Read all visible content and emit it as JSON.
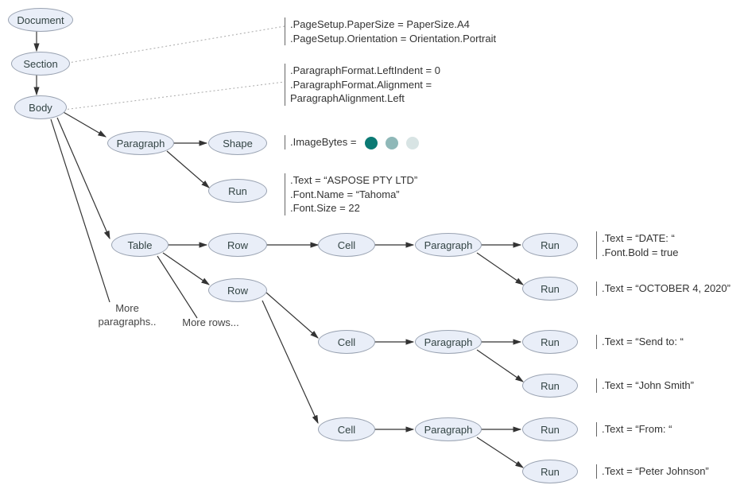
{
  "nodes": {
    "document": "Document",
    "section": "Section",
    "body": "Body",
    "paragraph1": "Paragraph",
    "shape": "Shape",
    "run_shape": "Run",
    "table": "Table",
    "row1": "Row",
    "row2": "Row",
    "cell1": "Cell",
    "cell2": "Cell",
    "cell3": "Cell",
    "para_c1": "Paragraph",
    "para_c2": "Paragraph",
    "para_c3": "Paragraph",
    "run_c1a": "Run",
    "run_c1b": "Run",
    "run_c2a": "Run",
    "run_c2b": "Run",
    "run_c3a": "Run",
    "run_c3b": "Run"
  },
  "annotations": {
    "section1": ".PageSetup.PaperSize = PaperSize.A4",
    "section2": ".PageSetup.Orientation = Orientation.Portrait",
    "para_fmt1": ".ParagraphFormat.LeftIndent = 0",
    "para_fmt2": ".ParagraphFormat.Alignment =",
    "para_fmt3": "ParagraphAlignment.Left",
    "imagebytes": ".ImageBytes =",
    "run1_l1": ".Text = “ASPOSE PTY LTD”",
    "run1_l2": ".Font.Name = “Tahoma”",
    "run1_l3": ".Font.Size = 22",
    "run_date1": ".Text = “DATE: “",
    "run_date2": ".Font.Bold = true",
    "run_oct": ".Text = “OCTOBER 4, 2020”",
    "run_sendto": ".Text = “Send to: “",
    "run_john": ".Text = “John Smith”",
    "run_from": ".Text = “From: “",
    "run_peter": ".Text = “Peter Johnson”"
  },
  "notes": {
    "more_para": "More\nparagraphs..",
    "more_rows": "More rows..."
  },
  "colors": {
    "dot1": "#0b7a74",
    "dot2": "#8fb8b8",
    "dot3": "#d8e4e4"
  },
  "chart_data": {
    "type": "tree",
    "title": "Aspose.Words Document Object Model (DOM) tree",
    "nodes": [
      {
        "id": "Document",
        "children": [
          "Section"
        ]
      },
      {
        "id": "Section",
        "children": [
          "Body"
        ],
        "props": {
          "PageSetup.PaperSize": "PaperSize.A4",
          "PageSetup.Orientation": "Orientation.Portrait"
        }
      },
      {
        "id": "Body",
        "children": [
          "Paragraph(1)",
          "Table",
          "More paragraphs.."
        ]
      },
      {
        "id": "Paragraph(1)",
        "children": [
          "Shape",
          "Run(1)"
        ],
        "props": {
          "ParagraphFormat.LeftIndent": 0,
          "ParagraphFormat.Alignment": "ParagraphAlignment.Left"
        }
      },
      {
        "id": "Shape",
        "props": {
          "ImageBytes": "..."
        }
      },
      {
        "id": "Run(1)",
        "props": {
          "Text": "ASPOSE PTY LTD",
          "Font.Name": "Tahoma",
          "Font.Size": 22
        }
      },
      {
        "id": "Table",
        "children": [
          "Row(1)",
          "Row(2)",
          "More rows..."
        ]
      },
      {
        "id": "Row(1)",
        "children": [
          "Cell(1)"
        ]
      },
      {
        "id": "Cell(1)",
        "children": [
          "Paragraph(2)"
        ]
      },
      {
        "id": "Paragraph(2)",
        "children": [
          "Run(2a)",
          "Run(2b)"
        ]
      },
      {
        "id": "Run(2a)",
        "props": {
          "Text": "DATE: ",
          "Font.Bold": true
        }
      },
      {
        "id": "Run(2b)",
        "props": {
          "Text": "OCTOBER 4, 2020"
        }
      },
      {
        "id": "Row(2)",
        "children": [
          "Cell(2)",
          "Cell(3)"
        ]
      },
      {
        "id": "Cell(2)",
        "children": [
          "Paragraph(3)"
        ]
      },
      {
        "id": "Paragraph(3)",
        "children": [
          "Run(3a)",
          "Run(3b)"
        ]
      },
      {
        "id": "Run(3a)",
        "props": {
          "Text": "Send to: "
        }
      },
      {
        "id": "Run(3b)",
        "props": {
          "Text": "John Smith"
        }
      },
      {
        "id": "Cell(3)",
        "children": [
          "Paragraph(4)"
        ]
      },
      {
        "id": "Paragraph(4)",
        "children": [
          "Run(4a)",
          "Run(4b)"
        ]
      },
      {
        "id": "Run(4a)",
        "props": {
          "Text": "From: "
        }
      },
      {
        "id": "Run(4b)",
        "props": {
          "Text": "Peter Johnson"
        }
      }
    ]
  }
}
